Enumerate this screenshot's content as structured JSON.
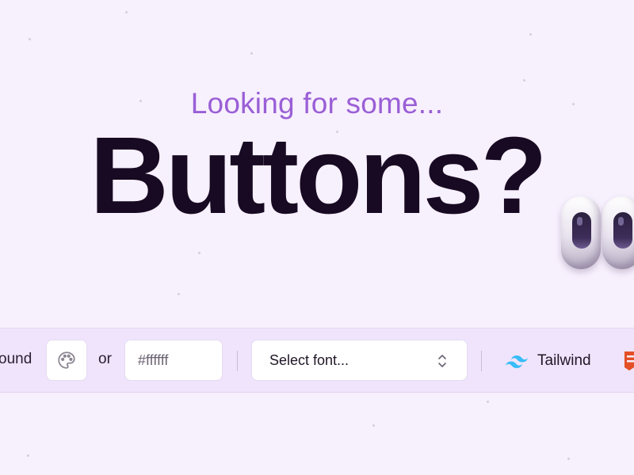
{
  "hero": {
    "subtitle": "Looking for some...",
    "headline": "Buttons?"
  },
  "toolbar": {
    "background_label": "ound",
    "or_label": "or",
    "color_input": {
      "value": "",
      "placeholder": "#ffffff"
    },
    "font_select": {
      "label": "Select font..."
    },
    "tailwind_label": "Tailwind",
    "icons": {
      "palette": "palette-icon",
      "chevron": "chevron-up-down-icon",
      "tailwind": "tailwind-logo-icon",
      "css": "css-logo-icon"
    }
  },
  "colors": {
    "background": "#f7f0fd",
    "subtitle": "#9a5fd6",
    "headline": "#170a22",
    "toolbar": "#efe4fb",
    "tailwind": "#38bdf8",
    "css": "#e34f26"
  }
}
